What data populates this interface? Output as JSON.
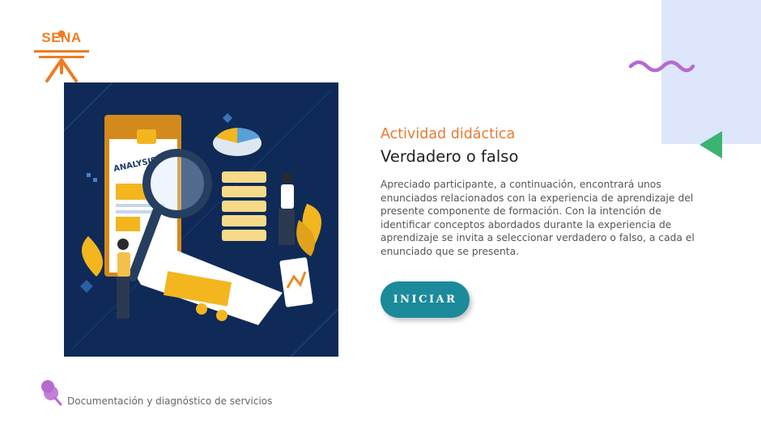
{
  "brand": {
    "logo_text": "SENA",
    "color": "#f07c20"
  },
  "colors": {
    "accent_orange": "#e97a30",
    "teal": "#1b8a9b",
    "purple": "#b56ad0",
    "green": "#3bb371",
    "light_blue": "#dde6fb",
    "navy": "#0f2a57"
  },
  "illustration": {
    "doc_label": "ANALYSIS"
  },
  "content": {
    "kicker": "Actividad didáctica",
    "title": "Verdadero o falso",
    "description": "Apreciado participante, a continuación, encontrará unos enunciados relacionados con la experiencia de aprendizaje del presente componente de formación. Con la intención de identificar conceptos abordados durante la experiencia de aprendizaje se invita a seleccionar verdadero o falso, a cada el enunciado que se presenta."
  },
  "start_button": {
    "label": "INICIAR"
  },
  "footer": {
    "text": "Documentación y diagnóstico de servicios",
    "icon": "pin-icon"
  }
}
